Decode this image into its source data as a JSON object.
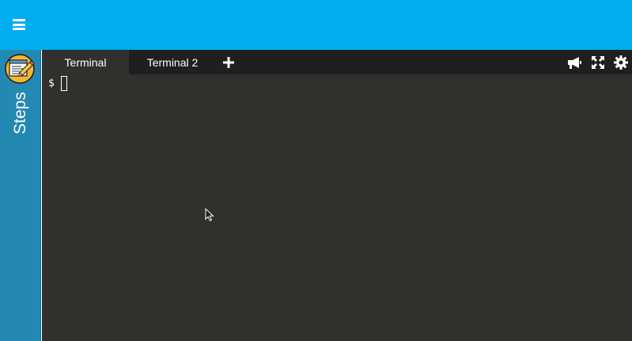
{
  "header": {
    "menu_icon": "hamburger-menu-icon",
    "bg_color": "#00adee"
  },
  "sidebar": {
    "label": "Steps",
    "logo_icon": "steps-notebook-pencil-icon",
    "bg_color": "#2389b2"
  },
  "terminal": {
    "tabs": [
      {
        "label": "Terminal",
        "active": true
      },
      {
        "label": "Terminal 2",
        "active": false
      }
    ],
    "add_tab_icon": "plus-icon",
    "toolbar_icons": [
      "megaphone-icon",
      "fullscreen-icon",
      "gear-icon"
    ],
    "prompt": "$",
    "bg_color": "#32302c"
  }
}
